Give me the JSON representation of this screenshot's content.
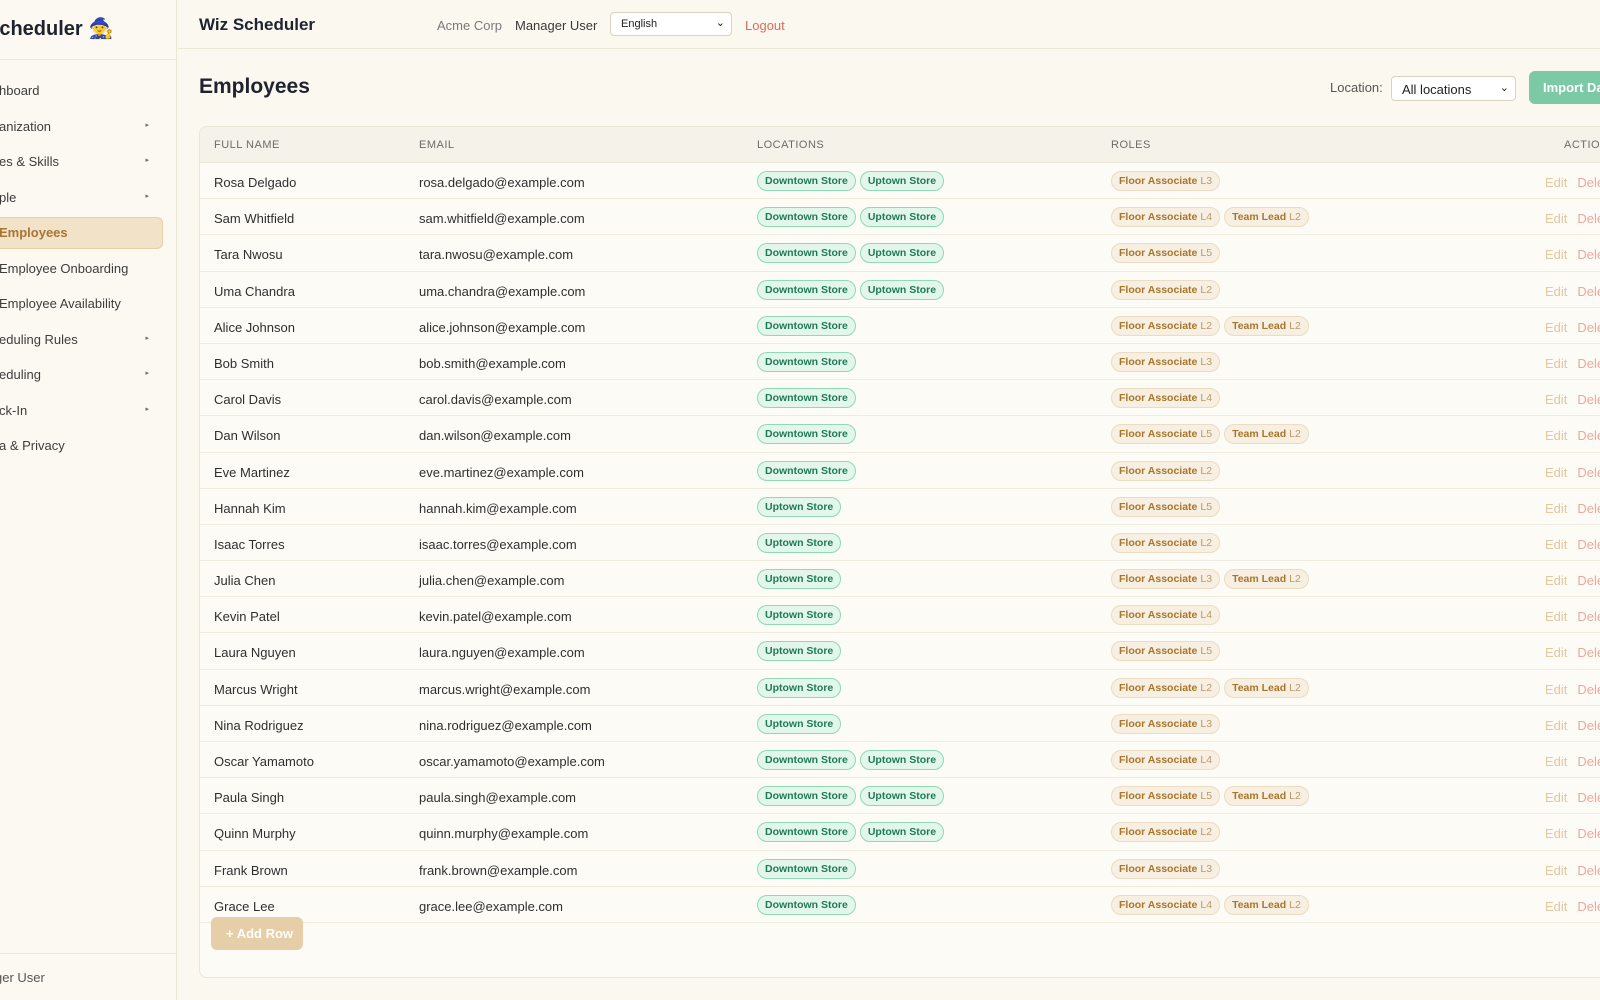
{
  "brand": {
    "title": "Scheduler",
    "logo_emoji": "🧙"
  },
  "sidebar": {
    "items": [
      {
        "label": "hboard",
        "caret": false,
        "active": false
      },
      {
        "label": "anization",
        "caret": true,
        "active": false
      },
      {
        "label": "es & Skills",
        "caret": true,
        "active": false
      },
      {
        "label": "ple",
        "caret": true,
        "active": false
      },
      {
        "label": "Employees",
        "caret": false,
        "active": true
      },
      {
        "label": "Employee Onboarding",
        "caret": false,
        "active": false
      },
      {
        "label": "Employee Availability",
        "caret": false,
        "active": false
      },
      {
        "label": "eduling Rules",
        "caret": true,
        "active": false
      },
      {
        "label": "eduling",
        "caret": true,
        "active": false
      },
      {
        "label": "ck-In",
        "caret": true,
        "active": false
      },
      {
        "label": "a & Privacy",
        "caret": false,
        "active": false
      }
    ],
    "footer_user": "ger User"
  },
  "topbar": {
    "app_title": "Wiz Scheduler",
    "org": "Acme Corp",
    "user": "Manager User",
    "language": "English",
    "logout": "Logout"
  },
  "page": {
    "title": "Employees",
    "location_label": "Location:",
    "location_value": "All locations",
    "import_button": "Import Da"
  },
  "table": {
    "headers": {
      "name": "FULL NAME",
      "email": "EMAIL",
      "locations": "LOCATIONS",
      "roles": "ROLES",
      "actions": "ACTION"
    },
    "edit_label": "Edit",
    "delete_label": "Dele",
    "rows": [
      {
        "name": "Rosa Delgado",
        "email": "rosa.delgado@example.com",
        "locations": [
          "Downtown Store",
          "Uptown Store"
        ],
        "roles": [
          {
            "name": "Floor Associate",
            "level": "L3"
          }
        ]
      },
      {
        "name": "Sam Whitfield",
        "email": "sam.whitfield@example.com",
        "locations": [
          "Downtown Store",
          "Uptown Store"
        ],
        "roles": [
          {
            "name": "Floor Associate",
            "level": "L4"
          },
          {
            "name": "Team Lead",
            "level": "L2"
          }
        ]
      },
      {
        "name": "Tara Nwosu",
        "email": "tara.nwosu@example.com",
        "locations": [
          "Downtown Store",
          "Uptown Store"
        ],
        "roles": [
          {
            "name": "Floor Associate",
            "level": "L5"
          }
        ]
      },
      {
        "name": "Uma Chandra",
        "email": "uma.chandra@example.com",
        "locations": [
          "Downtown Store",
          "Uptown Store"
        ],
        "roles": [
          {
            "name": "Floor Associate",
            "level": "L2"
          }
        ]
      },
      {
        "name": "Alice Johnson",
        "email": "alice.johnson@example.com",
        "locations": [
          "Downtown Store"
        ],
        "roles": [
          {
            "name": "Floor Associate",
            "level": "L2"
          },
          {
            "name": "Team Lead",
            "level": "L2"
          }
        ]
      },
      {
        "name": "Bob Smith",
        "email": "bob.smith@example.com",
        "locations": [
          "Downtown Store"
        ],
        "roles": [
          {
            "name": "Floor Associate",
            "level": "L3"
          }
        ]
      },
      {
        "name": "Carol Davis",
        "email": "carol.davis@example.com",
        "locations": [
          "Downtown Store"
        ],
        "roles": [
          {
            "name": "Floor Associate",
            "level": "L4"
          }
        ]
      },
      {
        "name": "Dan Wilson",
        "email": "dan.wilson@example.com",
        "locations": [
          "Downtown Store"
        ],
        "roles": [
          {
            "name": "Floor Associate",
            "level": "L5"
          },
          {
            "name": "Team Lead",
            "level": "L2"
          }
        ]
      },
      {
        "name": "Eve Martinez",
        "email": "eve.martinez@example.com",
        "locations": [
          "Downtown Store"
        ],
        "roles": [
          {
            "name": "Floor Associate",
            "level": "L2"
          }
        ]
      },
      {
        "name": "Hannah Kim",
        "email": "hannah.kim@example.com",
        "locations": [
          "Uptown Store"
        ],
        "roles": [
          {
            "name": "Floor Associate",
            "level": "L5"
          }
        ]
      },
      {
        "name": "Isaac Torres",
        "email": "isaac.torres@example.com",
        "locations": [
          "Uptown Store"
        ],
        "roles": [
          {
            "name": "Floor Associate",
            "level": "L2"
          }
        ]
      },
      {
        "name": "Julia Chen",
        "email": "julia.chen@example.com",
        "locations": [
          "Uptown Store"
        ],
        "roles": [
          {
            "name": "Floor Associate",
            "level": "L3"
          },
          {
            "name": "Team Lead",
            "level": "L2"
          }
        ]
      },
      {
        "name": "Kevin Patel",
        "email": "kevin.patel@example.com",
        "locations": [
          "Uptown Store"
        ],
        "roles": [
          {
            "name": "Floor Associate",
            "level": "L4"
          }
        ]
      },
      {
        "name": "Laura Nguyen",
        "email": "laura.nguyen@example.com",
        "locations": [
          "Uptown Store"
        ],
        "roles": [
          {
            "name": "Floor Associate",
            "level": "L5"
          }
        ]
      },
      {
        "name": "Marcus Wright",
        "email": "marcus.wright@example.com",
        "locations": [
          "Uptown Store"
        ],
        "roles": [
          {
            "name": "Floor Associate",
            "level": "L2"
          },
          {
            "name": "Team Lead",
            "level": "L2"
          }
        ]
      },
      {
        "name": "Nina Rodriguez",
        "email": "nina.rodriguez@example.com",
        "locations": [
          "Uptown Store"
        ],
        "roles": [
          {
            "name": "Floor Associate",
            "level": "L3"
          }
        ]
      },
      {
        "name": "Oscar Yamamoto",
        "email": "oscar.yamamoto@example.com",
        "locations": [
          "Downtown Store",
          "Uptown Store"
        ],
        "roles": [
          {
            "name": "Floor Associate",
            "level": "L4"
          }
        ]
      },
      {
        "name": "Paula Singh",
        "email": "paula.singh@example.com",
        "locations": [
          "Downtown Store",
          "Uptown Store"
        ],
        "roles": [
          {
            "name": "Floor Associate",
            "level": "L5"
          },
          {
            "name": "Team Lead",
            "level": "L2"
          }
        ]
      },
      {
        "name": "Quinn Murphy",
        "email": "quinn.murphy@example.com",
        "locations": [
          "Downtown Store",
          "Uptown Store"
        ],
        "roles": [
          {
            "name": "Floor Associate",
            "level": "L2"
          }
        ]
      },
      {
        "name": "Frank Brown",
        "email": "frank.brown@example.com",
        "locations": [
          "Downtown Store"
        ],
        "roles": [
          {
            "name": "Floor Associate",
            "level": "L3"
          }
        ]
      },
      {
        "name": "Grace Lee",
        "email": "grace.lee@example.com",
        "locations": [
          "Downtown Store"
        ],
        "roles": [
          {
            "name": "Floor Associate",
            "level": "L4"
          },
          {
            "name": "Team Lead",
            "level": "L2"
          }
        ]
      }
    ],
    "add_row_label": "+ Add Row"
  },
  "colors": {
    "accent_green": "#7ccaa5",
    "accent_gold": "#e6cfa8",
    "logout_red": "#e06a5c",
    "active_nav_bg": "#f1e2c8"
  }
}
